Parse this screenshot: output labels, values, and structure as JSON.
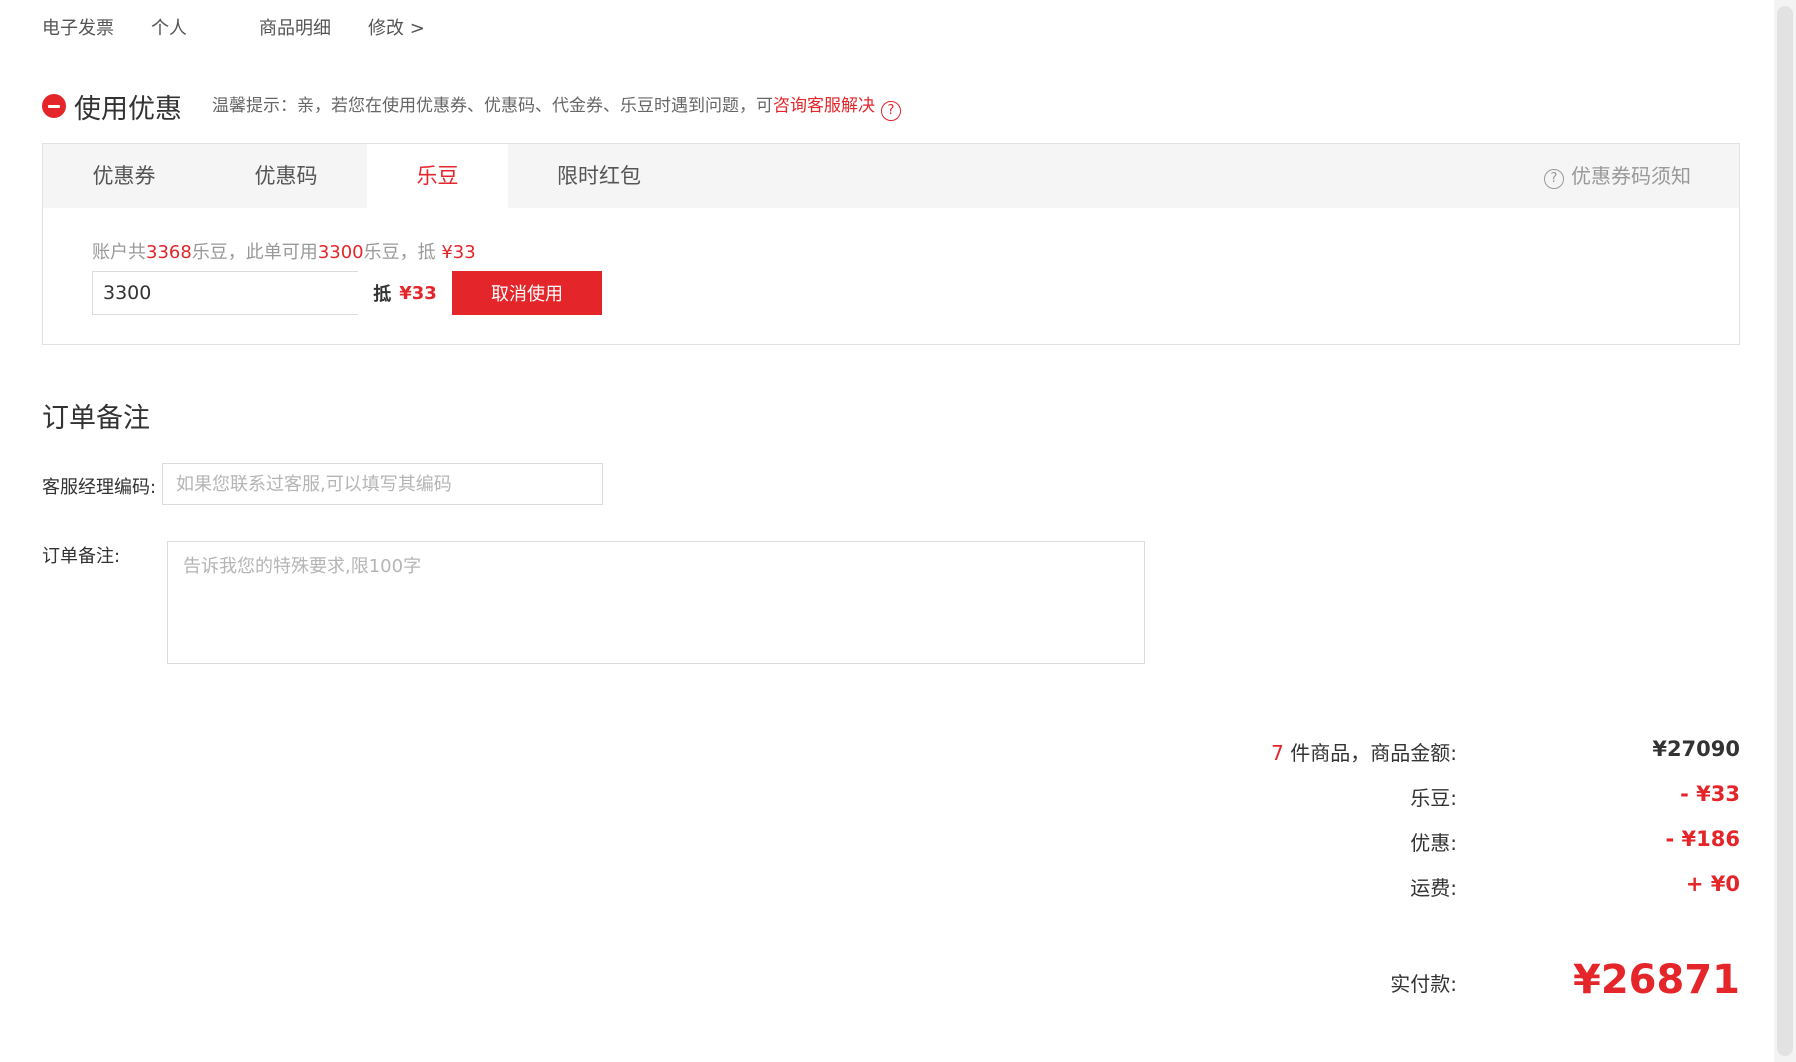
{
  "invoice": {
    "type": "电子发票",
    "title": "个人",
    "content": "商品明细",
    "edit_link": "修改 >"
  },
  "discount": {
    "title": "使用优惠",
    "tip_prefix": "温馨提示：亲，若您在使用优惠券、优惠码、代金券、乐豆时遇到问题，可",
    "tip_link": "咨询客服解决",
    "help_glyph": "?",
    "tabs": [
      {
        "label": "优惠券",
        "active": false
      },
      {
        "label": "优惠码",
        "active": false
      },
      {
        "label": "乐豆",
        "active": true
      },
      {
        "label": "限时红包",
        "active": false
      }
    ],
    "notice_label": "优惠券码须知",
    "ledou": {
      "info_1": "账户共",
      "total": "3368",
      "info_2": "乐豆，此单可用",
      "usable": "3300",
      "info_3": "乐豆，抵 ",
      "deduct": "¥33",
      "input_value": "3300",
      "di_label": "抵",
      "di_amount": "¥33",
      "cancel_label": "取消使用"
    }
  },
  "remarks": {
    "title": "订单备注",
    "manager_label": "客服经理编码:",
    "manager_placeholder": "如果您联系过客服,可以填写其编码",
    "note_label": "订单备注:",
    "note_placeholder": "告诉我您的特殊要求,限100字"
  },
  "summary": {
    "count": "7",
    "goods_label": " 件商品，商品金额:",
    "goods_amount": "¥27090",
    "ledou_label": "乐豆:",
    "ledou_amount": "- ¥33",
    "discount_label": "优惠:",
    "discount_amount": "- ¥186",
    "shipping_label": "运费:",
    "shipping_amount": "+ ¥0",
    "total_label": "实付款:",
    "total_amount": "¥26871"
  },
  "colors": {
    "accent": "#e4262a",
    "tab_bar": "#f5f5f5",
    "border": "#e2e2e2"
  },
  "icons": [
    "minus-circle-icon",
    "question-circle-icon"
  ]
}
